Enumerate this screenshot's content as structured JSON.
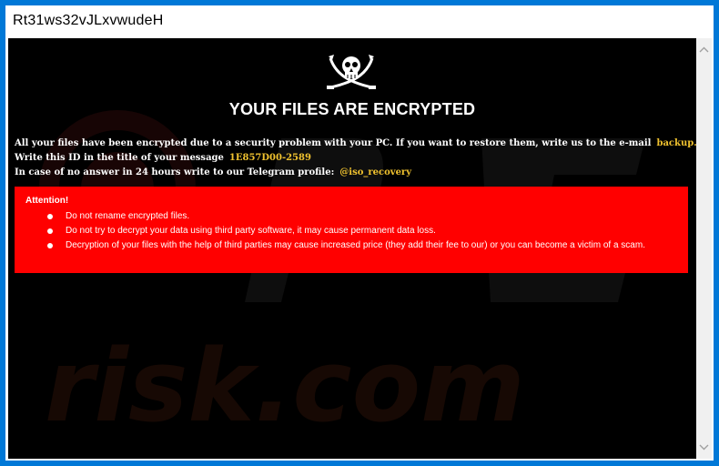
{
  "window": {
    "title": "Rt31ws32vJLxvwudeH"
  },
  "note": {
    "headline": "YOUR FILES ARE ENCRYPTED",
    "line1_text": "All your files have been encrypted due to a security problem with your PC. If you want to restore them, write us to the e-mail",
    "email": "backup.iso@aol.com",
    "line2_text": "Write this ID in the title of your message",
    "id": "1E857D00-2589",
    "line3_text": "In case of no answer in 24 hours write to our Telegram profile:",
    "telegram": "@iso_recovery"
  },
  "attention": {
    "title": "Attention!",
    "items": [
      "Do not rename encrypted files.",
      "Do not try to decrypt your data using third party software, it may cause permanent data loss.",
      "Decryption of your files with the help of third parties may cause increased price (they add their fee to our) or you can become a victim of a scam."
    ]
  },
  "watermark": {
    "text": "risk.com"
  },
  "icons": {
    "logo": "pirate-flag-skull-swords-icon",
    "scroll_up": "chevron-up-icon",
    "scroll_down": "chevron-down-icon"
  },
  "colors": {
    "window_border": "#0078d7",
    "background": "#000000",
    "alert_background": "#ff0000",
    "highlight": "#f0c22f",
    "text": "#ffffff"
  }
}
